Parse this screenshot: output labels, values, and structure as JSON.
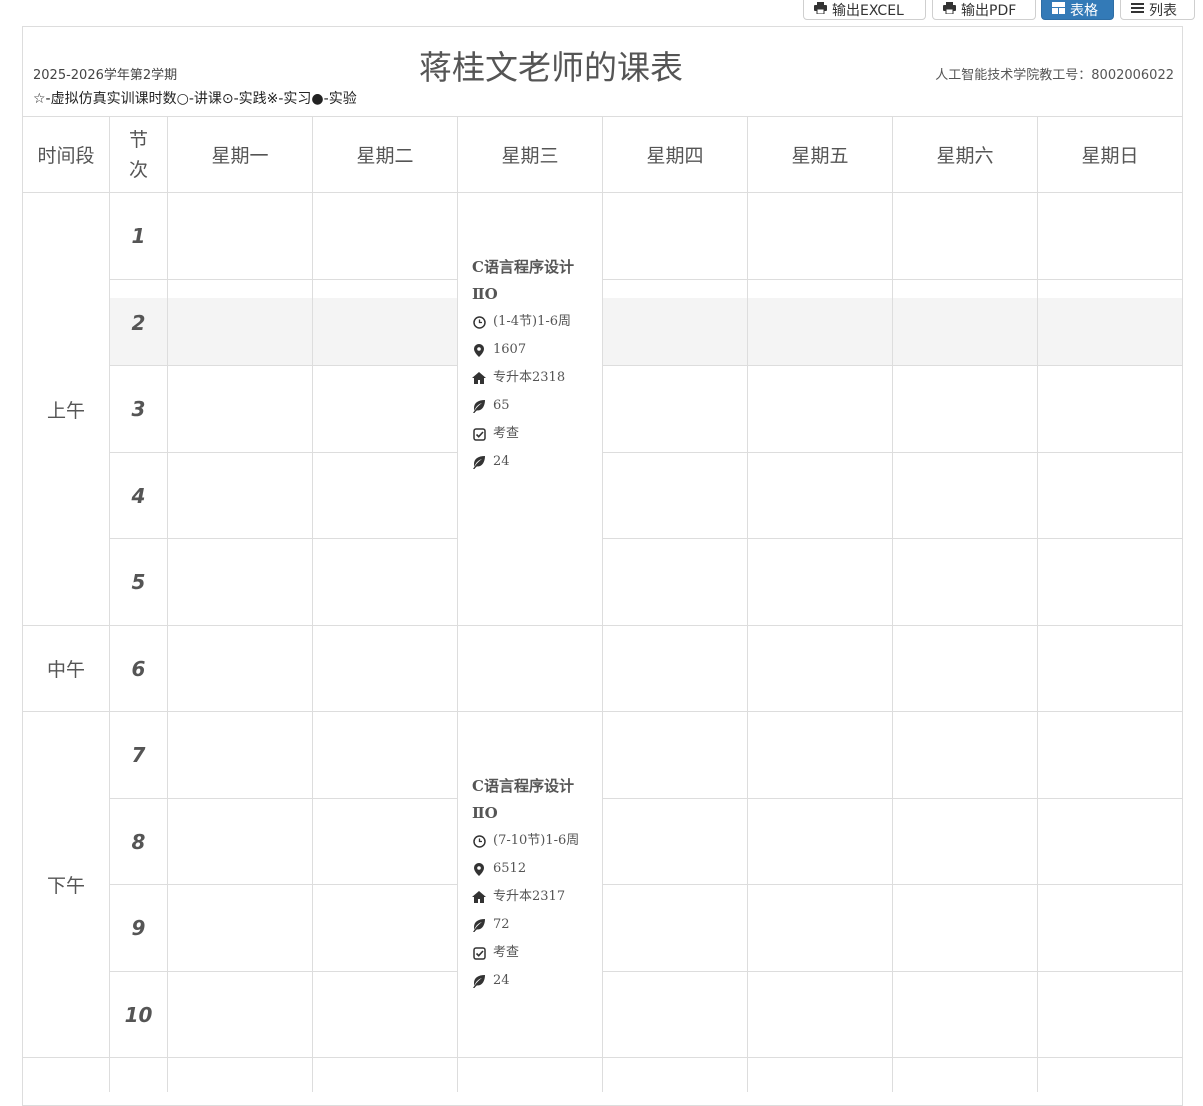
{
  "toolbar": {
    "export_excel": "输出EXCEL",
    "export_pdf": "输出PDF",
    "view_table": "表格",
    "view_list": "列表"
  },
  "header": {
    "semester": "2025-2026学年第2学期",
    "legend": "☆-虚拟仿真实训课时数○-讲课⊙-实践※-实习●-实验",
    "title": "蒋桂文老师的课表",
    "department": "人工智能技术学院教工号：8002006022"
  },
  "table": {
    "col_time": "时间段",
    "col_period": "节次",
    "days": [
      "星期一",
      "星期二",
      "星期三",
      "星期四",
      "星期五",
      "星期六",
      "星期日"
    ],
    "slots": [
      "上午",
      "中午",
      "下午"
    ],
    "periods": [
      "1",
      "2",
      "3",
      "4",
      "5",
      "6",
      "7",
      "8",
      "9",
      "10"
    ]
  },
  "courses": [
    {
      "name": "C语言程序设计ⅡO",
      "time": "(1-4节)1-6周",
      "room": "1607",
      "class": "专升本2318",
      "students": "65",
      "assessment": "考查",
      "hours": "24"
    },
    {
      "name": "C语言程序设计ⅡO",
      "time": "(7-10节)1-6周",
      "room": "6512",
      "class": "专升本2317",
      "students": "72",
      "assessment": "考查",
      "hours": "24"
    }
  ],
  "colors": {
    "primary": "#337ab7",
    "border": "#dddddd",
    "highlight": "#f4f4f4"
  }
}
